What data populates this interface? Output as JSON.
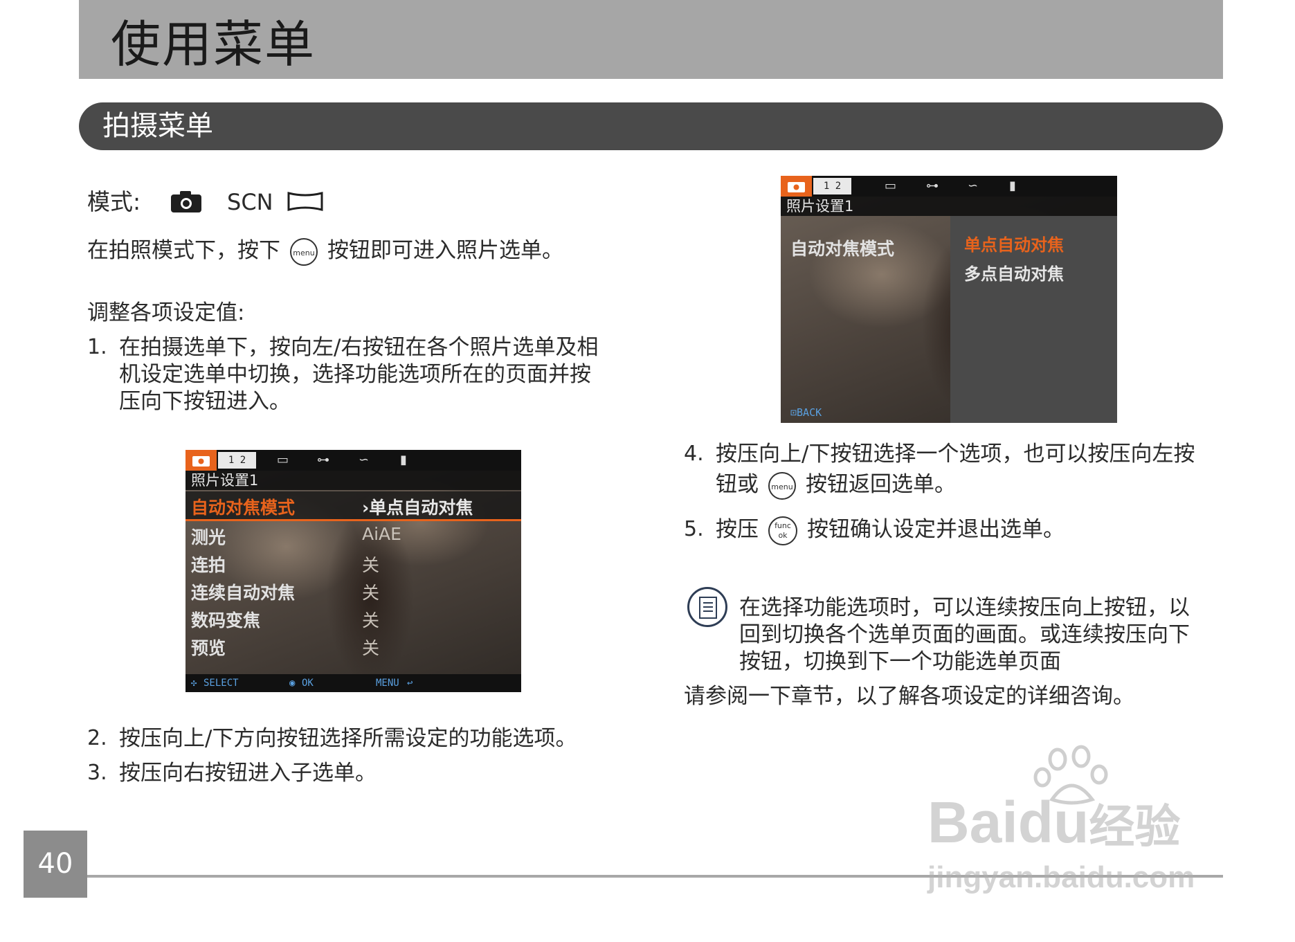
{
  "header": {
    "title": "使用菜单"
  },
  "section": {
    "title": "拍摄菜单"
  },
  "modes": {
    "label": "模式:",
    "scn": "SCN"
  },
  "intro": {
    "before": "在拍照模式下，按下",
    "btn": "menu",
    "after": "按钮即可进入照片选单。"
  },
  "adjust": {
    "heading": "调整各项设定值:"
  },
  "steps": [
    {
      "num": "1.",
      "lines": [
        "在拍摄选单下，按向左/右按钮在各个照片选单及相",
        "机设定选单中切换，选择功能选项所在的页面并按",
        "压向下按钮进入。"
      ]
    },
    {
      "num": "2.",
      "text": "按压向上/下方向按钮选择所需设定的功能选项。"
    },
    {
      "num": "3.",
      "text": "按压向右按钮进入子选单。"
    },
    {
      "num": "4.",
      "line1": "按压向上/下按钮选择一个选项，也可以按压向左按",
      "line2_before": "钮或",
      "btn": "menu",
      "line2_after": "按钮返回选单。"
    },
    {
      "num": "5.",
      "before": "按压",
      "btn_top": "func",
      "btn_bottom": "ok",
      "after": "按钮确认设定并退出选单。"
    }
  ],
  "screen1": {
    "page": "1 2",
    "subtitle": "照片设置1",
    "rows": [
      {
        "label": "自动对焦模式",
        "value": "›单点自动对焦"
      },
      {
        "label": "测光",
        "value": "AiAE"
      },
      {
        "label": "连拍",
        "value": "关"
      },
      {
        "label": "连续自动对焦",
        "value": "关"
      },
      {
        "label": "数码变焦",
        "value": "关"
      },
      {
        "label": "预览",
        "value": "关"
      }
    ],
    "bottom": {
      "select": "SELECT",
      "ok": "OK",
      "menu": "MENU"
    }
  },
  "screen2": {
    "page": "1 2",
    "subtitle": "照片设置1",
    "left_label": "自动对焦模式",
    "options": [
      "单点自动对焦",
      "多点自动对焦"
    ],
    "back": "BACK"
  },
  "note": {
    "lines": [
      "在选择功能选项时，可以连续按压向上按钮，以",
      "回到切换各个选单页面的画面。或连续按压向下",
      "按钮，切换到下一个功能选单页面"
    ]
  },
  "see_more": "请参阅一下章节，以了解各项设定的详细咨询。",
  "page_number": "40",
  "watermark": {
    "brand_a": "Bai",
    "brand_b": "du",
    "brand_c": "经验",
    "url": "jingyan.baidu.com"
  },
  "colors": {
    "accent": "#e8631c",
    "header": "#a6a6a6",
    "section": "#4a4a4a"
  },
  "icons": [
    "camera-icon",
    "panorama-icon",
    "menu-button-icon",
    "func-ok-button-icon",
    "note-icon"
  ]
}
